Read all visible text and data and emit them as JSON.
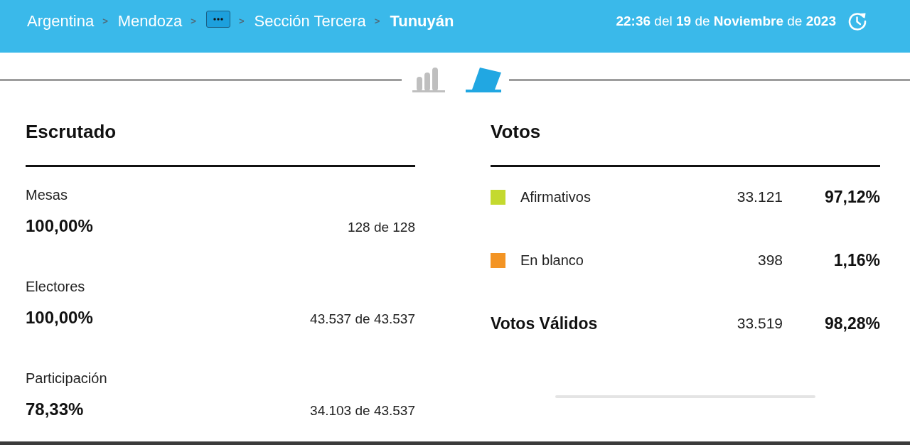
{
  "header": {
    "breadcrumb": [
      {
        "kind": "link",
        "label": "Argentina",
        "current": false,
        "separator": ">"
      },
      {
        "kind": "link",
        "label": "Mendoza",
        "current": false,
        "separator": ">"
      },
      {
        "kind": "more",
        "current": false,
        "separator": ">"
      },
      {
        "kind": "link",
        "label": "Sección Tercera",
        "current": false,
        "separator": ">"
      },
      {
        "kind": "link",
        "label": "Tunuyán",
        "current": true
      }
    ],
    "updated": "**22:36** del **19** de **Noviembre** de **2023**"
  },
  "view_tabs": [
    {
      "kind": "chart",
      "selected": false
    },
    {
      "kind": "ballot",
      "selected": true
    }
  ],
  "escrutado": {
    "title": "Escrutado",
    "rows": [
      {
        "label": "Mesas",
        "percent": "100,00%",
        "count": "128 de 128"
      },
      {
        "label": "Electores",
        "percent": "100,00%",
        "count": "43.537 de 43.537"
      },
      {
        "label": "Participación",
        "percent": "78,33%",
        "count": "34.103 de 43.537"
      }
    ]
  },
  "votos": {
    "title": "Votos",
    "rows": [
      {
        "kind": "option",
        "label": "Afirmativos",
        "color": "#c4d92f",
        "count": "33.121",
        "percent": "97,12%"
      },
      {
        "kind": "option",
        "label": "En blanco",
        "color": "#f39424",
        "count": "398",
        "percent": "1,16%"
      },
      {
        "kind": "total",
        "label": "Votos Válidos",
        "count": "33.519",
        "percent": "98,28%"
      }
    ]
  }
}
